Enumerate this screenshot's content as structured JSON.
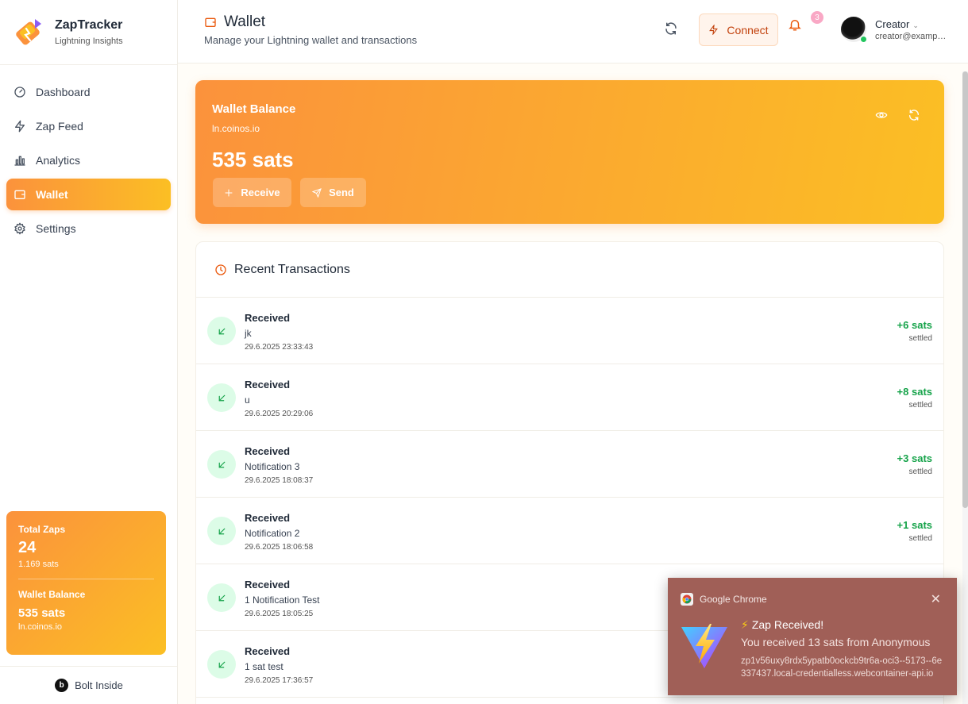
{
  "brand": {
    "name": "ZapTracker",
    "subtitle": "Lightning Insights"
  },
  "sidebar": {
    "items": [
      {
        "label": "Dashboard",
        "icon": "gauge-icon"
      },
      {
        "label": "Zap Feed",
        "icon": "bolt-icon"
      },
      {
        "label": "Analytics",
        "icon": "bar-chart-icon"
      },
      {
        "label": "Wallet",
        "icon": "wallet-icon",
        "active": true
      },
      {
        "label": "Settings",
        "icon": "gear-icon"
      }
    ],
    "stats": {
      "total_zaps_label": "Total Zaps",
      "total_zaps_value": "24",
      "total_zaps_sats": "1.169 sats",
      "wallet_label": "Wallet Balance",
      "wallet_value": "535 sats",
      "wallet_provider": "ln.coinos.io"
    },
    "footer": {
      "badge": "b",
      "label": "Bolt Inside"
    }
  },
  "header": {
    "title": "Wallet",
    "subtitle": "Manage your Lightning wallet and transactions",
    "connect_label": "Connect",
    "notification_count": "3",
    "user_name": "Creator",
    "user_email": "creator@example.com"
  },
  "balance": {
    "title": "Wallet Balance",
    "provider": "ln.coinos.io",
    "amount": "535 sats",
    "receive_label": "Receive",
    "send_label": "Send"
  },
  "transactions": {
    "title": "Recent Transactions",
    "items": [
      {
        "type": "Received",
        "memo": "jk",
        "date": "29.6.2025 23:33:43",
        "amount": "+6 sats",
        "status": "settled"
      },
      {
        "type": "Received",
        "memo": "u",
        "date": "29.6.2025 20:29:06",
        "amount": "+8 sats",
        "status": "settled"
      },
      {
        "type": "Received",
        "memo": "Notification 3",
        "date": "29.6.2025 18:08:37",
        "amount": "+3 sats",
        "status": "settled"
      },
      {
        "type": "Received",
        "memo": "Notification 2",
        "date": "29.6.2025 18:06:58",
        "amount": "+1 sats",
        "status": "settled"
      },
      {
        "type": "Received",
        "memo": "1 Notification Test",
        "date": "29.6.2025 18:05:25",
        "amount": "",
        "status": ""
      },
      {
        "type": "Received",
        "memo": "1 sat test",
        "date": "29.6.2025 17:36:57",
        "amount": "",
        "status": ""
      }
    ]
  },
  "notification": {
    "app": "Google Chrome",
    "title": "Zap Received!",
    "body": "You received 13 sats from Anonymous",
    "origin": "zp1v56uxy8rdx5ypatb0ockcb9tr6a-oci3--5173--6e337437.local-credentialless.webcontainer-api.io"
  },
  "colors": {
    "accent_start": "#fb923c",
    "accent_end": "#fbbf24",
    "positive": "#16a34a",
    "toast_bg": "#a05f57"
  }
}
